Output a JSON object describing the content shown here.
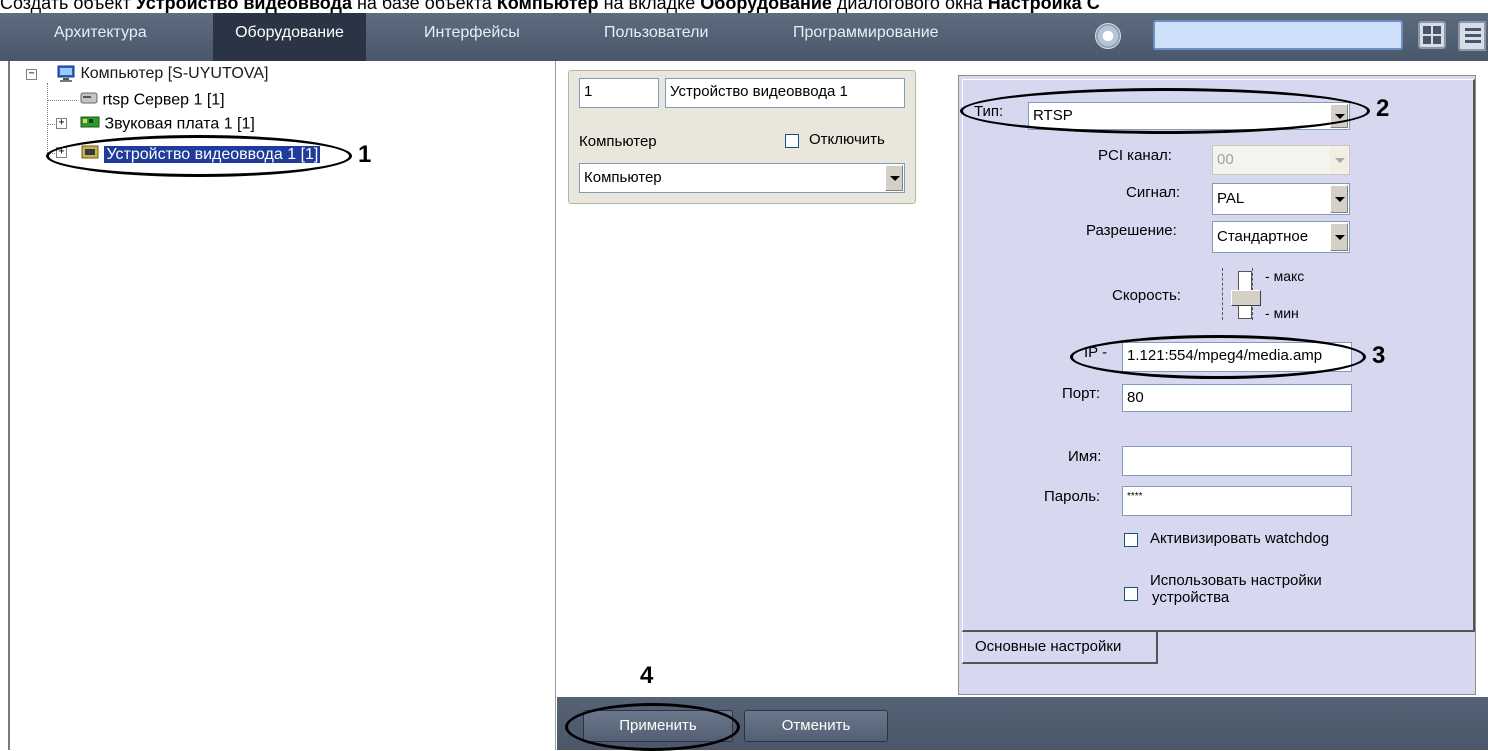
{
  "caption": {
    "p1": "Создать объект ",
    "b1": "Устройство видеоввода",
    "p2": " на базе объекта ",
    "b2": "Компьютер",
    "p3": " на вкладке ",
    "b3": "Оборудование",
    "p4": " диалогового окна ",
    "b4": "Настройка С"
  },
  "menu": {
    "items": [
      "Архитектура",
      "Оборудование",
      "Интерфейсы",
      "Пользователи",
      "Программирование"
    ],
    "active_index": 1,
    "search_value": ""
  },
  "tree": {
    "root": "Компьютер [S-UYUTOVA]",
    "children": [
      "rtsp Сервер 1 [1]",
      "Звуковая плата 1 [1]",
      "Устройство видеоввода 1 [1]"
    ],
    "selected_index": 2
  },
  "object": {
    "id": "1",
    "name": "Устройство видеоввода 1",
    "computer_label": "Компьютер",
    "disable_label": "Отключить",
    "disable_checked": false,
    "computer_value": "Компьютер"
  },
  "settings": {
    "type_label": "Тип:",
    "type_value": "RTSP",
    "pci_label": "PCI канал:",
    "pci_value": "00",
    "signal_label": "Сигнал:",
    "signal_value": "PAL",
    "resolution_label": "Разрешение:",
    "resolution_value": "Стандартное",
    "speed_label": "Скорость:",
    "speed_max": "макс",
    "speed_min": "мин",
    "ip_label": "IP -",
    "ip_value": "1.121:554/mpeg4/media.amp",
    "port_label": "Порт:",
    "port_value": "80",
    "name_label": "Имя:",
    "name_value": "",
    "password_label": "Пароль:",
    "password_value": "****",
    "watchdog_label": "Активизировать  watchdog",
    "watchdog_checked": false,
    "device_settings_line1": "Использовать настройки",
    "device_settings_line2": "устройства",
    "device_settings_checked": false,
    "tab_label": "Основные настройки"
  },
  "buttons": {
    "apply": "Применить",
    "cancel": "Отменить"
  },
  "callouts": [
    "1",
    "2",
    "3",
    "4"
  ],
  "colors": {
    "menubar": "#4f5c70",
    "menu_active": "#2b3445",
    "panel": "#d8d7f0",
    "selection": "#1f3c9c"
  }
}
